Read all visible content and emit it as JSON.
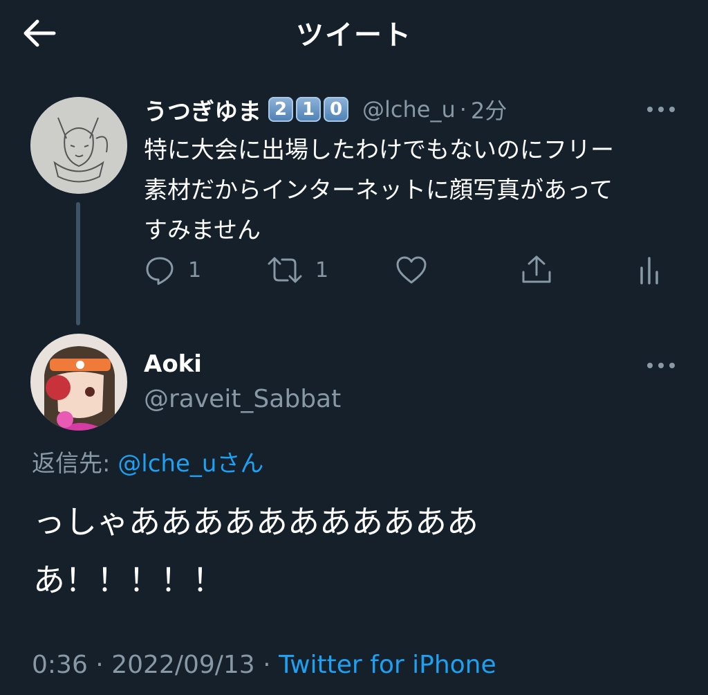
{
  "header": {
    "title": "ツイート"
  },
  "tweet1": {
    "author_name": "うつぎゆま",
    "badges": [
      "2",
      "1",
      "0"
    ],
    "handle": "@lche_u",
    "separator": "·",
    "time": "2分",
    "text_lines": [
      "特に大会に出場したわけでもないのにフリー",
      "素材だからインターネットに顔写真があって",
      "すみません"
    ],
    "reply_count": "1",
    "retweet_count": "1"
  },
  "tweet2": {
    "author_name": "Aoki",
    "handle": "@raveit_Sabbat",
    "reply_to_label": "返信先:",
    "reply_to_handle": "@lche_u",
    "reply_to_suffix": "さん",
    "text_lines": [
      "っしゃあああああああああああ",
      "あ！！！！！"
    ],
    "time": "0:36",
    "dot1": "·",
    "date": "2022/09/13",
    "dot2": "·",
    "client": "Twitter for iPhone"
  },
  "colors": {
    "background": "#15202b",
    "link": "#1da1f2",
    "muted": "#8899a6"
  }
}
